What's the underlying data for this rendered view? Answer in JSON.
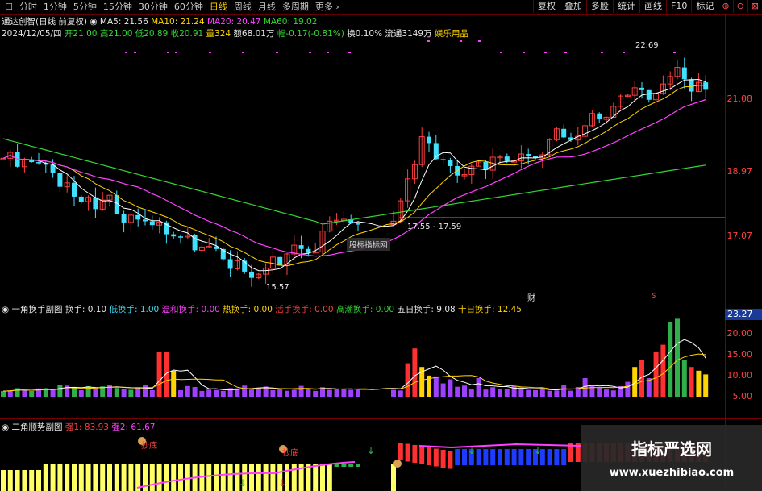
{
  "toolbar": {
    "tabs": [
      "分时",
      "1分钟",
      "5分钟",
      "15分钟",
      "30分钟",
      "60分钟",
      "日线",
      "周线",
      "月线",
      "多周期",
      "更多"
    ],
    "active_tab": "日线",
    "right_tools": [
      "复权",
      "叠加",
      "多股",
      "统计",
      "画线",
      "F10",
      "标记"
    ]
  },
  "info": {
    "stock": "通达创智(日线 前复权)",
    "ma5": "MA5: 21.56",
    "ma10": "MA10: 21.24",
    "ma20": "MA20: 20.47",
    "ma60": "MA60: 19.02",
    "date": "2024/12/05/四",
    "open": "开21.00",
    "high": "高21.00",
    "low": "低20.89",
    "close": "收20.91",
    "volume": "量324",
    "amount": "额68.01万",
    "change": "幅-0.17(-0.81%)",
    "turnover": "换0.10%",
    "float": "流通3149万",
    "sector": "娱乐用品"
  },
  "price_axis": [
    "21.08",
    "18.97",
    "17.07"
  ],
  "annotations": {
    "high": "22.69",
    "low": "15.57",
    "range": "17.55 - 17.59",
    "mark_label": "股标指标网",
    "cai": "财",
    "s_mark": "s"
  },
  "sub1": {
    "title": "一角换手副图",
    "items": [
      {
        "text": "换手: 0.10",
        "color": "#e6e6e6"
      },
      {
        "text": "低换手: 1.00",
        "color": "#40e0ff"
      },
      {
        "text": "温和换手: 0.00",
        "color": "#ff40ff"
      },
      {
        "text": "热换手: 0.00",
        "color": "#ffd400"
      },
      {
        "text": "活手换手: 0.00",
        "color": "#ff4040"
      },
      {
        "text": "高潮换手: 0.00",
        "color": "#33d633"
      },
      {
        "text": "五日换手: 9.08",
        "color": "#e6e6e6"
      },
      {
        "text": "十日换手: 12.45",
        "color": "#ffd400"
      }
    ],
    "axis": [
      "23.27",
      "20.00",
      "15.00",
      "10.00",
      "5.00"
    ]
  },
  "sub2": {
    "title": "二角顺势副图",
    "strong1": "强1: 83.93",
    "strong2": "强2: 61.67",
    "labels": [
      "抄底",
      "抄底"
    ]
  },
  "watermark": {
    "title": "指标严选网",
    "url": "www.xuezhibiao.com"
  }
}
